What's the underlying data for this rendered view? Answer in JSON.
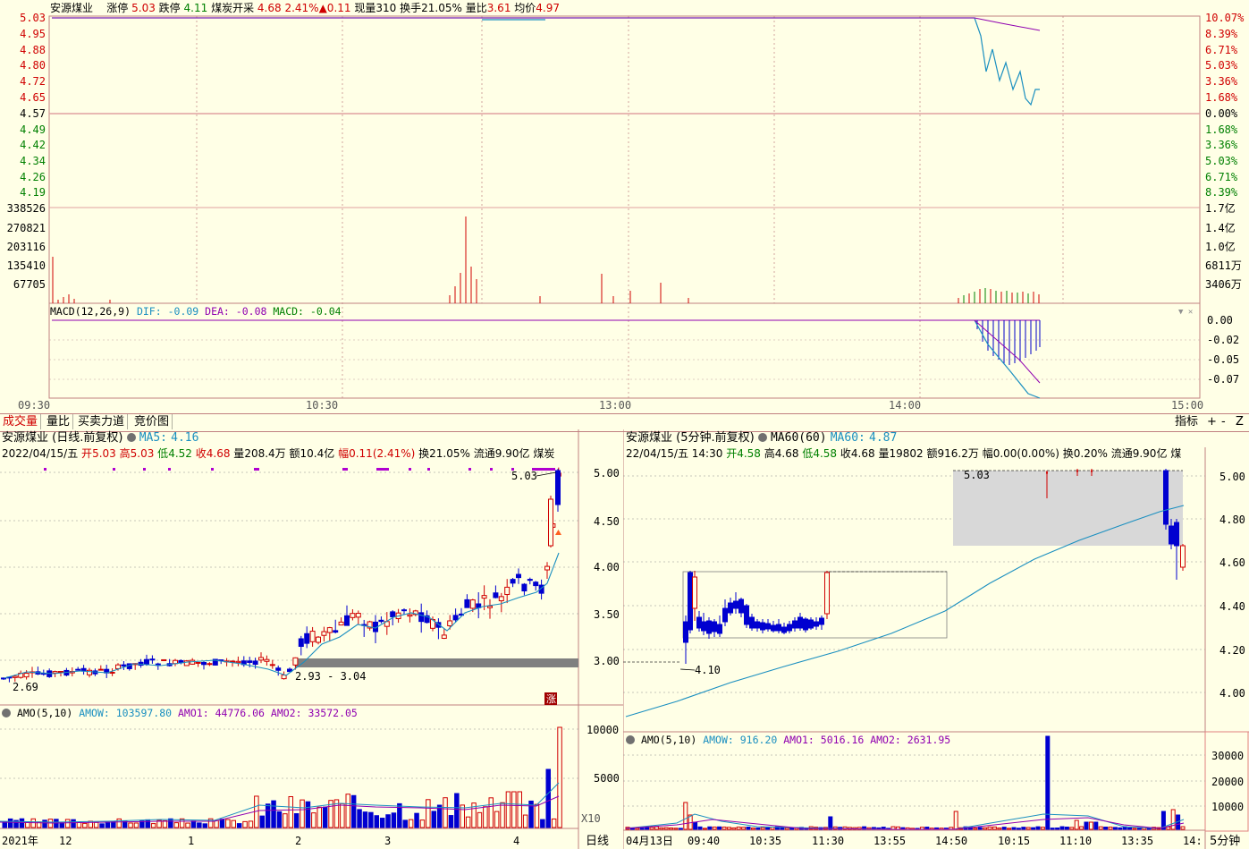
{
  "intraday": {
    "header": {
      "name": "安源煤业",
      "limit_up_label": "涨停",
      "limit_up": "5.03",
      "limit_down_label": "跌停",
      "limit_down": "4.11",
      "sector": "煤炭开采",
      "price": "4.68",
      "pct": "2.41%",
      "change": "▲0.11",
      "vol_label": "现量",
      "vol": "310",
      "turnover_label": "换手",
      "turnover": "21.05%",
      "ratio_label": "量比",
      "ratio": "3.61",
      "avg_label": "均价",
      "avg": "4.97"
    },
    "price_axis_left": [
      "5.03",
      "4.95",
      "4.88",
      "4.80",
      "4.72",
      "4.65",
      "4.57",
      "4.49",
      "4.42",
      "4.34",
      "4.26",
      "4.19"
    ],
    "price_axis_right": [
      "10.07%",
      "8.39%",
      "6.71%",
      "5.03%",
      "3.36%",
      "1.68%",
      "0.00%",
      "1.68%",
      "3.36%",
      "5.03%",
      "6.71%",
      "8.39%"
    ],
    "volume_axis_left": [
      "338526",
      "270821",
      "203116",
      "135410",
      "67705"
    ],
    "volume_axis_right": [
      "1.7亿",
      "1.4亿",
      "1.0亿",
      "6811万",
      "3406万"
    ],
    "macd": {
      "name": "MACD(12,26,9)",
      "dif_label": "DIF:",
      "dif": "-0.09",
      "dea_label": "DEA:",
      "dea": "-0.08",
      "macd_label": "MACD:",
      "macd": "-0.04"
    },
    "macd_axis": [
      "0.00",
      "-0.02",
      "-0.05",
      "-0.07"
    ],
    "time_axis": [
      "09:30",
      "10:30",
      "13:00",
      "14:00",
      "15:00"
    ]
  },
  "tabs": [
    "成交量",
    "量比",
    "买卖力道",
    "竞价图"
  ],
  "right_tools": {
    "indicator": "指标",
    "plus": "+",
    "minus": "-",
    "z": "Z"
  },
  "daily": {
    "title": "安源煤业 (日线.前复权)",
    "ma_label": "MA5:",
    "ma": "4.16",
    "line2": {
      "date": "2022/04/15/五",
      "open_label": "开",
      "open": "5.03",
      "high_label": "高",
      "high": "5.03",
      "low_label": "低",
      "low": "4.52",
      "close_label": "收",
      "close": "4.68",
      "vol_label": "量",
      "vol": "208.4万",
      "amt_label": "额",
      "amt": "10.4亿",
      "amp_label": "幅",
      "amp": "0.11(2.41%)",
      "turn_label": "换",
      "turn": "21.05%",
      "float_label": "流通",
      "float": "9.90亿",
      "sector": "煤炭"
    },
    "axis": [
      "5.00",
      "4.50",
      "4.00",
      "3.50",
      "3.00"
    ],
    "annot_high": "5.03",
    "annot_low": "2.69",
    "annot_range": "2.93 - 3.04",
    "badge": "涨",
    "amo": {
      "name": "AMO(5,10)",
      "w_label": "AMOW:",
      "w": "103597.80",
      "a1_label": "AMO1:",
      "a1": "44776.06",
      "a2_label": "AMO2:",
      "a2": "33572.05"
    },
    "amo_axis": [
      "10000",
      "5000"
    ],
    "amo_unit": "X10",
    "time_axis": [
      "2021年",
      "12",
      "1",
      "2",
      "3",
      "4"
    ],
    "period": "日线"
  },
  "minute": {
    "title": "安源煤业 (5分钟.前复权)",
    "ma_label": "MA60(60)",
    "ma_name": "MA60:",
    "ma": "4.87",
    "line2": {
      "date": "22/04/15/五",
      "time": "14:30",
      "open_label": "开",
      "open": "4.58",
      "high_label": "高",
      "high": "4.68",
      "low_label": "低",
      "low": "4.58",
      "close_label": "收",
      "close": "4.68",
      "vol_label": "量",
      "vol": "19802",
      "amt_label": "额",
      "amt": "916.2万",
      "amp_label": "幅",
      "amp": "0.00(0.00%)",
      "turn_label": "换",
      "turn": "0.20%",
      "float_label": "流通",
      "float": "9.90亿",
      "sector": "煤"
    },
    "axis": [
      "5.00",
      "4.80",
      "4.60",
      "4.40",
      "4.20",
      "4.00"
    ],
    "annot_high": "5.03",
    "annot_low": "4.10",
    "amo": {
      "name": "AMO(5,10)",
      "w_label": "AMOW:",
      "w": "916.20",
      "a1_label": "AMO1:",
      "a1": "5016.16",
      "a2_label": "AMO2:",
      "a2": "2631.95"
    },
    "amo_axis": [
      "30000",
      "20000",
      "10000"
    ],
    "time_axis": [
      "04月13日",
      "09:40",
      "10:35",
      "11:30",
      "13:55",
      "14:50",
      "10:15",
      "11:10",
      "13:35",
      "14:"
    ],
    "period": "5分钟"
  },
  "colors": {
    "up": "#d00000",
    "down": "#0000d0",
    "ma": "#1a8fc0",
    "avg": "#9000b0",
    "grid": "#c08080",
    "bg": "#ffffe6"
  }
}
